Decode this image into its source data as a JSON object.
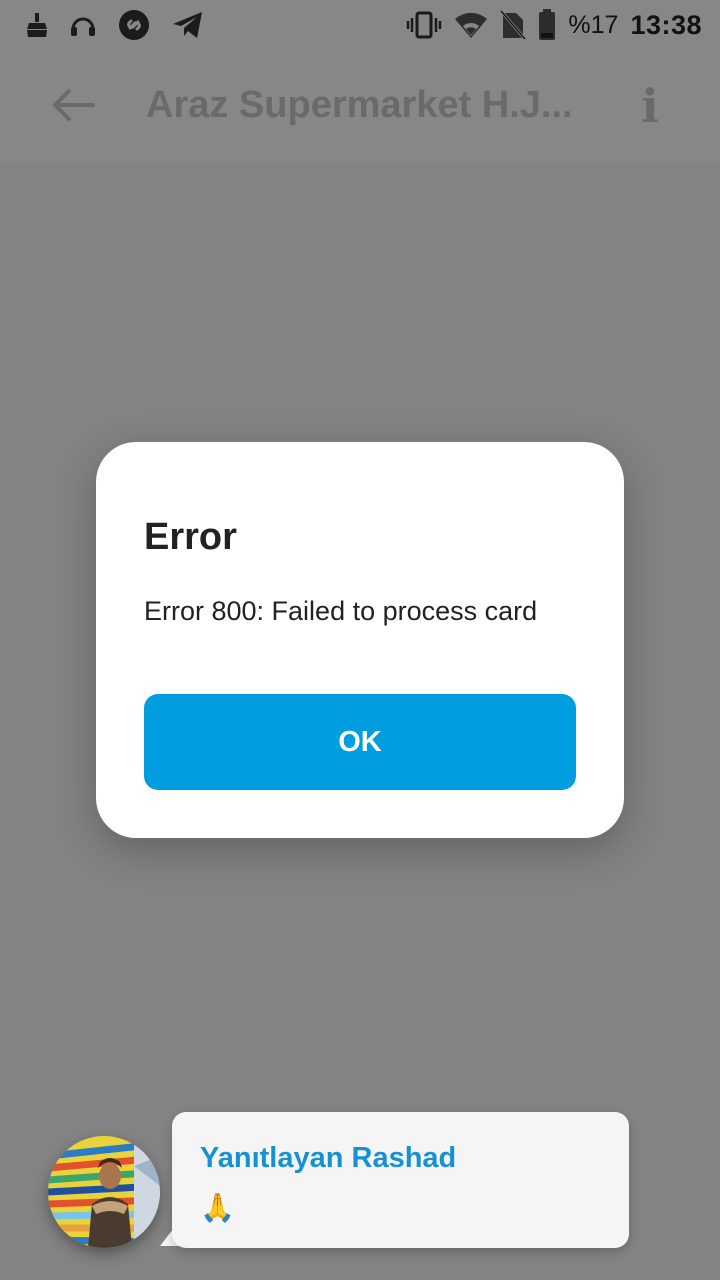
{
  "status_bar": {
    "battery_percent": "%17",
    "time": "13:38"
  },
  "app_bar": {
    "title": "Araz Supermarket H.J..."
  },
  "dialog": {
    "title": "Error",
    "message": "Error 800: Failed to process card",
    "ok_label": "OK"
  },
  "reply_bubble": {
    "name": "Yanıtlayan Rashad",
    "message": "🙏"
  },
  "colors": {
    "accent": "#009ee0",
    "reply_name": "#1692d4"
  }
}
